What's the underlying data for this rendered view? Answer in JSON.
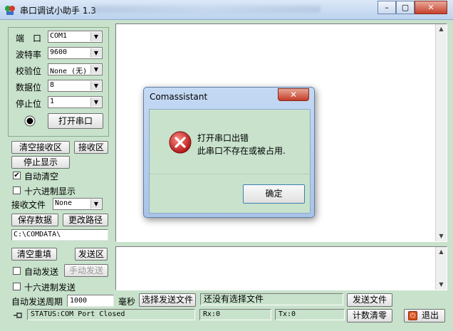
{
  "window": {
    "title": "串口调试小助手 1.3",
    "min_label": "–",
    "max_label": "▢",
    "close_label": "✕"
  },
  "settings": {
    "port_label": "端　口",
    "port_value": "COM1",
    "baud_label": "波特率",
    "baud_value": "9600",
    "parity_label": "校验位",
    "parity_value": "None (无)",
    "databits_label": "数据位",
    "databits_value": "8",
    "stopbits_label": "停止位",
    "stopbits_value": "1",
    "open_port_label": "打开串口"
  },
  "receive": {
    "clear_label": "清空接收区",
    "area_label": "接收区",
    "stop_display_label": "停止显示",
    "auto_clear_label": "自动清空",
    "auto_clear_checked": true,
    "hex_display_label": "十六进制显示",
    "hex_display_checked": false,
    "file_label": "接收文件",
    "file_value": "None",
    "save_data_label": "保存数据",
    "change_path_label": "更改路径",
    "path_value": "C:\\COMDATA\\"
  },
  "send": {
    "clear_label": "清空重填",
    "area_label": "发送区",
    "auto_send_label": "自动发送",
    "manual_send_label": "手动发送",
    "hex_send_label": "十六进制发送",
    "period_label": "自动发送周期",
    "period_value": "1000",
    "ms_label": "毫秒",
    "select_file_label": "选择发送文件",
    "file_status": "还没有选择文件",
    "send_file_label": "发送文件"
  },
  "statusbar": {
    "status_text": "STATUS:COM Port Closed",
    "rx_text": "Rx:0",
    "tx_text": "Tx:0",
    "reset_count_label": "计数清零",
    "exit_label": "退出"
  },
  "dialog": {
    "title": "Comassistant",
    "close_label": "✕",
    "line1": "打开串口出错",
    "line2": "此串口不存在或被占用.",
    "ok_label": "确定"
  },
  "colors": {
    "background": "#c8e2cc",
    "error_red": "#c8242a"
  }
}
